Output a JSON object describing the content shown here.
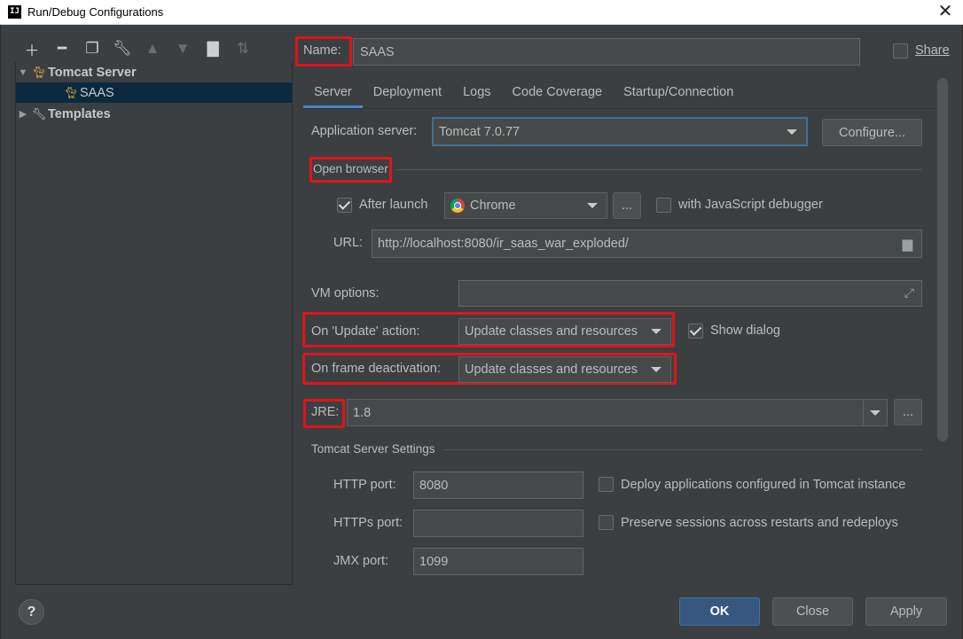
{
  "window": {
    "title": "Run/Debug Configurations",
    "app_icon": "IJ"
  },
  "toolbar": {
    "icons": [
      "add-icon",
      "remove-icon",
      "copy-icon",
      "wrench-icon",
      "move-up-icon",
      "move-down-icon",
      "folder-add-icon",
      "sort-icon"
    ]
  },
  "tree": {
    "tomcat_server": "Tomcat Server",
    "saas": "SAAS",
    "templates": "Templates"
  },
  "name": {
    "label": "Name:",
    "value": "SAAS"
  },
  "share": {
    "label": "Share",
    "checked": false
  },
  "tabs": [
    "Server",
    "Deployment",
    "Logs",
    "Code Coverage",
    "Startup/Connection"
  ],
  "server": {
    "app_server_label": "Application server:",
    "app_server_value": "Tomcat 7.0.77",
    "configure_button": "Configure...",
    "open_browser_label": "Open browser",
    "after_launch_label": "After launch",
    "after_launch_checked": true,
    "browser_value": "Chrome",
    "browse_button": "...",
    "js_debugger_label": "with JavaScript debugger",
    "url_label": "URL:",
    "url_value": "http://localhost:8080/ir_saas_war_exploded/",
    "vm_options_label": "VM options:",
    "vm_options_value": "",
    "on_update_label": "On 'Update' action:",
    "on_update_value": "Update classes and resources",
    "show_dialog_label": "Show dialog",
    "show_dialog_checked": true,
    "on_frame_label": "On frame deactivation:",
    "on_frame_value": "Update classes and resources",
    "jre_label": "JRE:",
    "jre_value": "1.8",
    "jre_browse_button": "...",
    "tomcat_settings_label": "Tomcat Server Settings",
    "http_port_label": "HTTP port:",
    "http_port_value": "8080",
    "deploy_label": "Deploy applications configured in Tomcat instance",
    "https_port_label": "HTTPs port:",
    "https_port_value": "",
    "preserve_label": "Preserve sessions across restarts and redeploys",
    "jmx_port_label": "JMX port:",
    "jmx_port_value": "1099"
  },
  "footer": {
    "help": "?",
    "ok": "OK",
    "close": "Close",
    "apply": "Apply"
  },
  "colors": {
    "background": "#3c3f41",
    "selection": "#0d293e",
    "highlight": "#e0141b",
    "primary_button": "#365880",
    "tab_underline": "#4a88c7"
  }
}
